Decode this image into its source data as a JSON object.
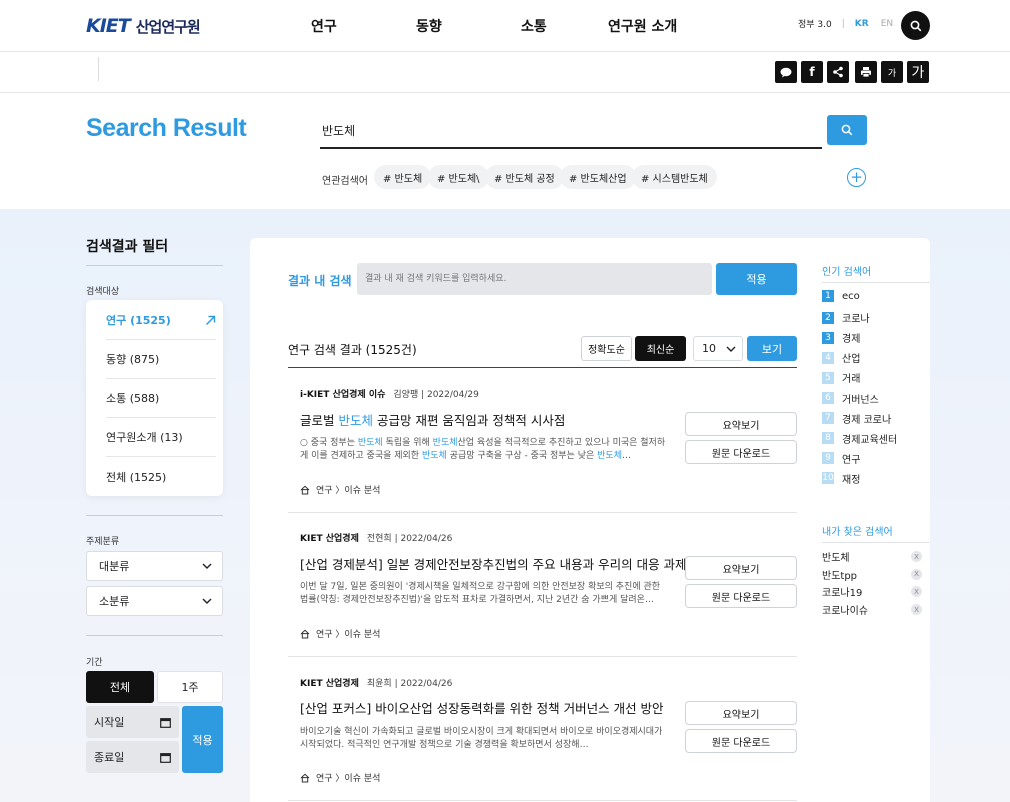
{
  "header": {
    "logo_mark": "KIET",
    "logo_text": "산업연구원",
    "nav": [
      "연구",
      "동향",
      "소통",
      "연구원 소개"
    ],
    "gov": "정부 3.0",
    "lang_kr": "KR",
    "lang_en": "EN"
  },
  "share": {
    "font_small": "가",
    "font_large": "가"
  },
  "search": {
    "title": "Search Result",
    "query": "반도체",
    "related_label": "연관검색어",
    "related": [
      "# 반도체",
      "# 반도체\\",
      "# 반도체 공정",
      "# 반도체산업",
      "# 시스템반도체"
    ]
  },
  "filter": {
    "title": "검색결과 필터",
    "target_label": "검색대상",
    "targets": [
      "연구 (1525)",
      "동향 (875)",
      "소통 (588)",
      "연구원소개 (13)",
      "전체 (1525)"
    ],
    "subject_label": "주제분류",
    "major": "대분류",
    "minor": "소분류",
    "period_label": "기간",
    "period_all": "전체",
    "period_week": "1주",
    "start_date": "시작일",
    "end_date": "종료일",
    "apply": "적용"
  },
  "content": {
    "inner_label": "결과 내 검색",
    "inner_placeholder": "결과 내 재 검색 키워드를 입력하세요.",
    "inner_apply": "적용",
    "count_title": "연구 검색 결과 (1525건)",
    "sort_accuracy": "정확도순",
    "sort_latest": "최신순",
    "page_size": "10",
    "view": "보기",
    "summary_btn": "요약보기",
    "download_btn": "원문 다운로드",
    "results": [
      {
        "source": "i-KIET 산업경제 이슈",
        "author_date": "김양팽 | 2022/04/29",
        "title_pre": "글로벌 ",
        "title_hl": "반도체",
        "title_post": " 공급망 재편 움직임과 정책적 시사점",
        "desc": "○ 중국 정부는 반도체 독립을 위해 반도체산업 육성을 적극적으로 추진하고 있으나 미국은 철저하게 이를 견제하고 중국을 제외한 반도체 공급망 구축을 구상 - 중국 정부는 낮은 반도체…",
        "category": "연구 〉이슈 분석"
      },
      {
        "source": "KIET 산업경제",
        "author_date": "전현희 | 2022/04/26",
        "title_pre": "[산업 경제분석] 일본 경제안전보장추진법의 주요 내용과 우리의 대응 과제",
        "title_hl": "",
        "title_post": "",
        "desc": "이번 달 7일, 일본 중의원이 '경제시책을 일체적으로 강구함에 의한 안전보장 확보의 추진에 관한 법률(약칭: 경제안전보장추진법)'을 압도적 표차로 가결하면서, 지난 2년간 숨 가쁘게 달려온…",
        "category": "연구 〉이슈 분석"
      },
      {
        "source": "KIET 산업경제",
        "author_date": "최윤희 | 2022/04/26",
        "title_pre": "[산업 포커스] 바이오산업 성장동력화를 위한 정책 거버넌스 개선 방안",
        "title_hl": "",
        "title_post": "",
        "desc": "바이오기술 혁신이 가속화되고 글로벌 바이오시장이 크게 확대되면서 바이오로 바이오경제시대가 시작되었다. 적극적인 연구개발 정책으로 기술 경쟁력을 확보하면서 성장해…",
        "category": "연구 〉이슈 분석"
      }
    ]
  },
  "sidebar": {
    "popular_title": "인기 검색어",
    "popular": [
      "eco",
      "코로나",
      "경제",
      "산업",
      "거래",
      "거버넌스",
      "경제 코로나",
      "경제교육센터",
      "연구",
      "재정"
    ],
    "popular_ranks": [
      "1",
      "2",
      "3",
      "4",
      "5",
      "6",
      "7",
      "8",
      "9",
      "10"
    ],
    "my_title": "내가 찾은 검색어",
    "my": [
      "반도체",
      "반도tpp",
      "코로나19",
      "코로나이슈"
    ],
    "remove_glyph": "X"
  },
  "colors": {
    "accent": "#2e9be0",
    "dark": "#111111"
  }
}
